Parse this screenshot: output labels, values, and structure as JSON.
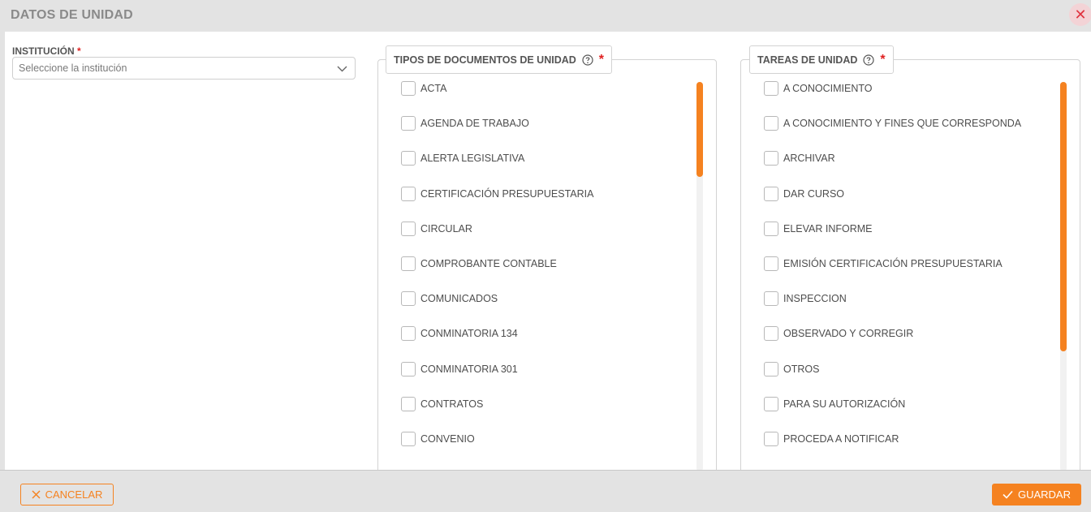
{
  "header": {
    "title": "DATOS DE UNIDAD",
    "close_glyph": "✕"
  },
  "institucion": {
    "label": "INSTITUCIÓN",
    "required_mark": "*",
    "placeholder": "Seleccione la institución"
  },
  "tipos": {
    "legend": "TIPOS DE DOCUMENTOS DE UNIDAD",
    "required_mark": "*",
    "help_icon": "help-circle-icon",
    "items": [
      "ACTA",
      "AGENDA DE TRABAJO",
      "ALERTA LEGISLATIVA",
      "CERTIFICACIÓN PRESUPUESTARIA",
      "CIRCULAR",
      "COMPROBANTE CONTABLE",
      "COMUNICADOS",
      "CONMINATORIA 134",
      "CONMINATORIA 301",
      "CONTRATOS",
      "CONVENIO"
    ]
  },
  "tareas": {
    "legend": "TAREAS DE UNIDAD",
    "required_mark": "*",
    "help_icon": "help-circle-icon",
    "items": [
      "A CONOCIMIENTO",
      "A CONOCIMIENTO Y FINES QUE CORRESPONDA",
      "ARCHIVAR",
      "DAR CURSO",
      "ELEVAR INFORME",
      "EMISIÓN CERTIFICACIÓN PRESUPUESTARIA",
      "INSPECCION",
      "OBSERVADO Y CORREGIR",
      "OTROS",
      "PARA SU AUTORIZACIÓN",
      "PROCEDA A NOTIFICAR"
    ]
  },
  "footer": {
    "cancel_label": "CANCELAR",
    "save_label": "GUARDAR"
  },
  "colors": {
    "accent": "#f58220",
    "required": "#e02020",
    "close_bg": "#f3d3d6",
    "close_fg": "#e0333f"
  }
}
